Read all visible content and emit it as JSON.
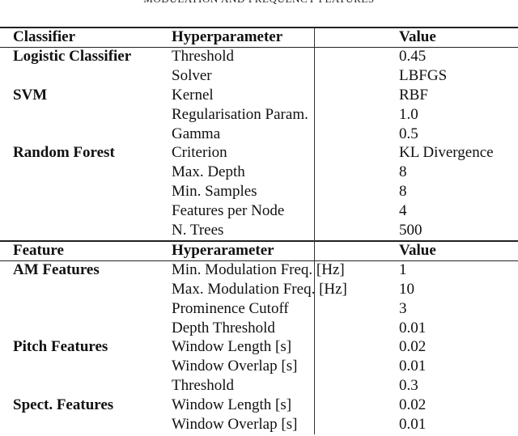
{
  "caption": "MODULATION AND FREQUENCY FEATURES",
  "classifier_table": {
    "headers": [
      "Classifier",
      "Hyperparameter",
      "Value"
    ],
    "rows": [
      {
        "group": "Logistic Classifier",
        "param": "Threshold",
        "value": "0.45"
      },
      {
        "group": "",
        "param": "Solver",
        "value": "LBFGS"
      },
      {
        "group": "SVM",
        "param": "Kernel",
        "value": "RBF"
      },
      {
        "group": "",
        "param": "Regularisation Param.",
        "value": "1.0"
      },
      {
        "group": "",
        "param": "Gamma",
        "value": "0.5"
      },
      {
        "group": "Random Forest",
        "param": "Criterion",
        "value": "KL Divergence"
      },
      {
        "group": "",
        "param": "Max. Depth",
        "value": "8"
      },
      {
        "group": "",
        "param": "Min. Samples",
        "value": "8"
      },
      {
        "group": "",
        "param": "Features per Node",
        "value": "4"
      },
      {
        "group": "",
        "param": "N. Trees",
        "value": "500"
      }
    ]
  },
  "feature_table": {
    "headers": [
      "Feature",
      "Hyperarameter",
      "Value"
    ],
    "rows": [
      {
        "group": "AM Features",
        "param": "Min. Modulation Freq. [Hz]",
        "value": "1"
      },
      {
        "group": "",
        "param": "Max. Modulation Freq. [Hz]",
        "value": "10"
      },
      {
        "group": "",
        "param": "Prominence Cutoff",
        "value": "3"
      },
      {
        "group": "",
        "param": "Depth Threshold",
        "value": "0.01"
      },
      {
        "group": "Pitch Features",
        "param": "Window Length [s]",
        "value": "0.02"
      },
      {
        "group": "",
        "param": "Window Overlap [s]",
        "value": "0.01"
      },
      {
        "group": "",
        "param": "Threshold",
        "value": "0.3"
      },
      {
        "group": "Spect. Features",
        "param": "Window Length [s]",
        "value": "0.02"
      },
      {
        "group": "",
        "param": "Window Overlap [s]",
        "value": "0.01"
      }
    ]
  }
}
